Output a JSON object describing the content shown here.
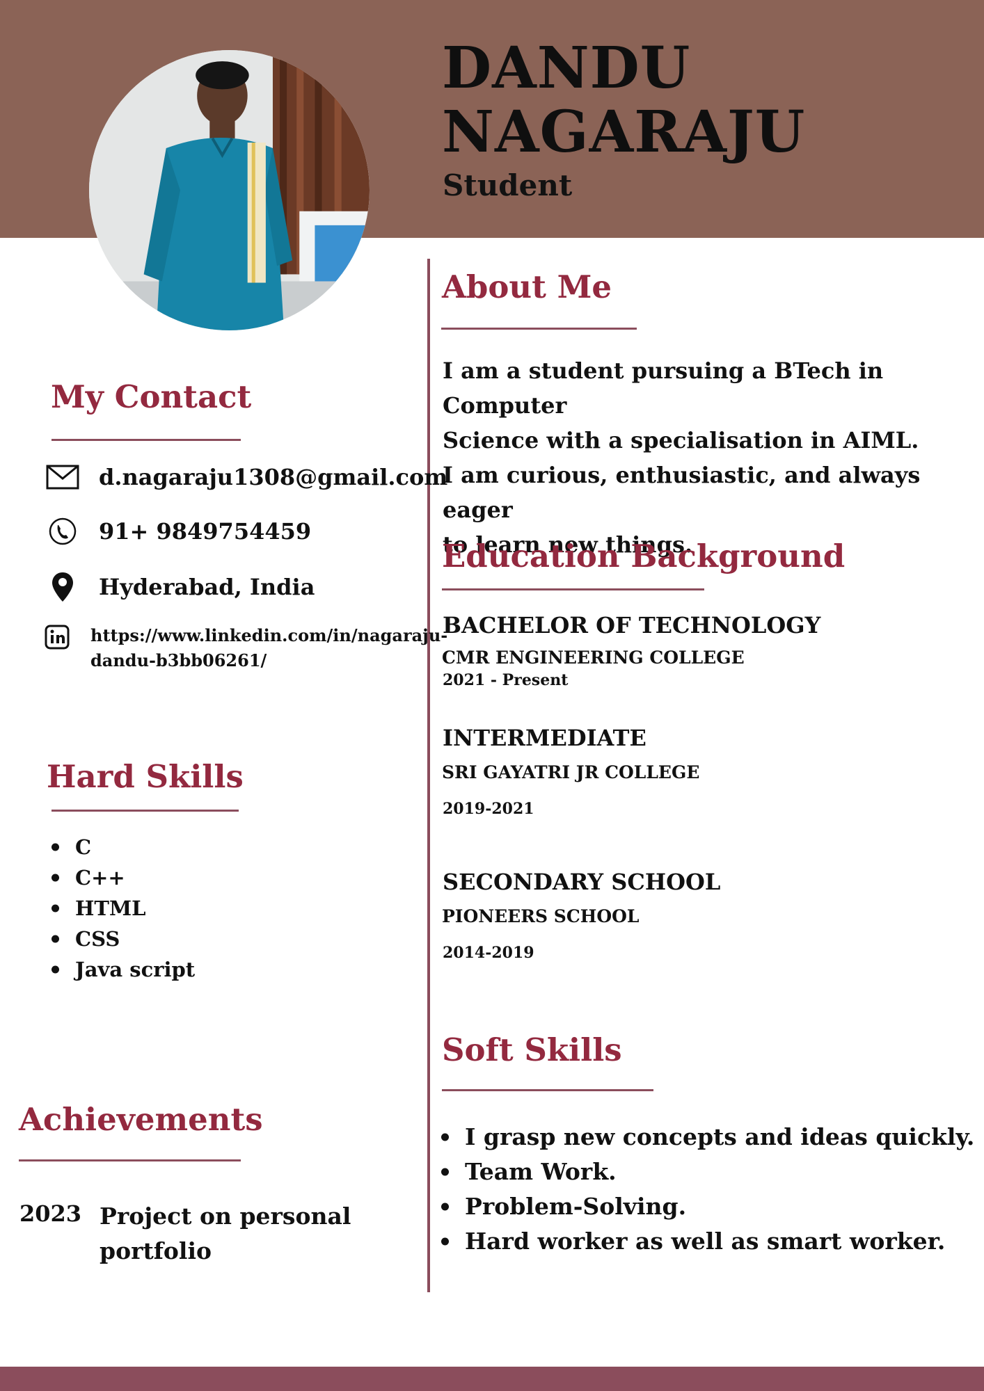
{
  "colors": {
    "header": "#8b6356",
    "accent": "#93293f",
    "rule": "#8b4d5c"
  },
  "header": {
    "name_line1": "DANDU",
    "name_line2": "NAGARAJU",
    "title": "Student"
  },
  "contact": {
    "heading": "My Contact",
    "email": "d.nagaraju1308@gmail.com",
    "phone": "91+ 9849754459",
    "location": "Hyderabad, India",
    "linkedin_line1": "https://www.linkedin.com/in/nagaraju-",
    "linkedin_line2": "dandu-b3bb06261/",
    "icons": [
      "mail-icon",
      "phone-icon",
      "location-pin-icon",
      "linkedin-icon"
    ]
  },
  "hard_skills": {
    "heading": "Hard Skills",
    "items": [
      "C",
      "C++",
      "HTML",
      "CSS",
      "Java script"
    ]
  },
  "achievements": {
    "heading": "Achievements",
    "items": [
      {
        "year": "2023",
        "line1": "Project on personal",
        "line2": "portfolio"
      }
    ]
  },
  "about": {
    "heading": "About Me",
    "lines": [
      "I am a student pursuing a BTech in Computer",
      "Science with a specialisation in AIML.",
      "I am curious, enthusiastic, and always eager",
      "to learn new things."
    ]
  },
  "education": {
    "heading": "Education Background",
    "entries": [
      {
        "degree": "BACHELOR OF TECHNOLOGY",
        "school": "CMR ENGINEERING COLLEGE",
        "years": "2021 - Present"
      },
      {
        "degree": "INTERMEDIATE",
        "school": "SRI GAYATRI JR COLLEGE",
        "years": "2019-2021"
      },
      {
        "degree": "SECONDARY SCHOOL",
        "school": "PIONEERS SCHOOL",
        "years": "2014-2019"
      }
    ]
  },
  "soft_skills": {
    "heading": "Soft Skills",
    "items": [
      "I grasp new concepts and ideas quickly.",
      "Team Work.",
      "Problem-Solving.",
      "Hard worker as well as smart worker."
    ]
  }
}
